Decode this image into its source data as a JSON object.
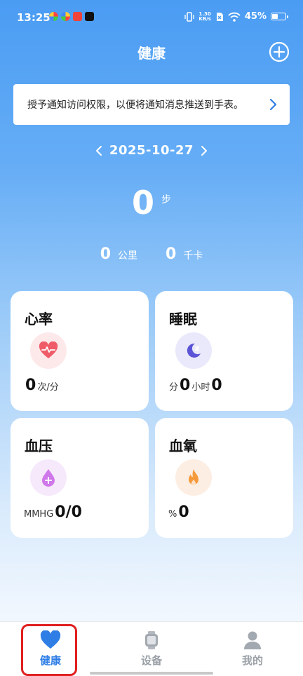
{
  "status_bar": {
    "time": "13:25",
    "speed_value": "1.30",
    "speed_unit": "KB/s",
    "battery": "45%",
    "battery_level": 0.45
  },
  "header": {
    "title": "健康"
  },
  "notice": {
    "text": "授予通知访问权限，以便将通知消息推送到手表。"
  },
  "date": {
    "value": "2025-10-27"
  },
  "steps": {
    "value": "0",
    "unit": "步"
  },
  "distance": {
    "value": "0",
    "unit": "公里"
  },
  "calories": {
    "value": "0",
    "unit": "千卡"
  },
  "cards": {
    "heart_rate": {
      "title": "心率",
      "value": "0",
      "unit": "次/分",
      "icon": "heart-pulse-icon",
      "icon_bg": "#fde9ea",
      "icon_color": "#ef5b68"
    },
    "sleep": {
      "title": "睡眠",
      "unit_min": "分",
      "value_min": "0",
      "unit_hour": "小时",
      "value_hour": "0",
      "icon": "moon-icon",
      "icon_bg": "#e9e9fb",
      "icon_color": "#5b54d6"
    },
    "blood_pressure": {
      "title": "血压",
      "unit": "MMHG",
      "value": "0/0",
      "icon": "blood-drop-icon",
      "icon_bg": "#f6e9fb",
      "icon_color": "#cf78ea"
    },
    "blood_oxygen": {
      "title": "血氧",
      "unit": "%",
      "value": "0",
      "icon": "flame-icon",
      "icon_bg": "#fdeee3",
      "icon_color": "#f59a3c"
    }
  },
  "tabs": {
    "health": {
      "label": "健康",
      "icon": "heart-icon",
      "active": true
    },
    "device": {
      "label": "设备",
      "icon": "watch-icon"
    },
    "mine": {
      "label": "我的",
      "icon": "person-icon"
    }
  },
  "colors": {
    "accent": "#2f7ee6",
    "inactive": "#9aa0a6",
    "highlight": "#e02020"
  }
}
